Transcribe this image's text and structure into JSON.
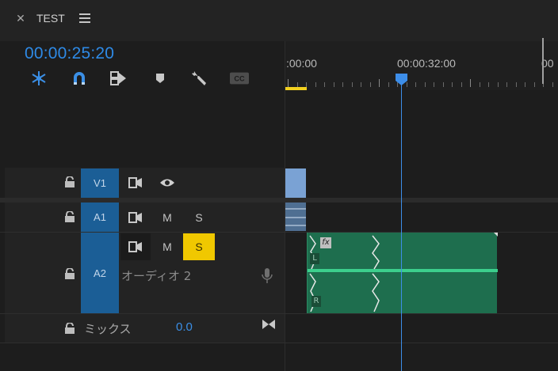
{
  "tab": {
    "close_icon": "close-icon",
    "title": "TEST",
    "menu_icon": "menu-icon"
  },
  "timecode": "00:00:25:20",
  "toolbar": [
    {
      "name": "nest-toggle-icon"
    },
    {
      "name": "snap-magnet-icon"
    },
    {
      "name": "linked-selection-icon"
    },
    {
      "name": "add-marker-icon"
    },
    {
      "name": "wrench-settings-icon"
    },
    {
      "name": "captions-cc-icon",
      "label": "CC"
    }
  ],
  "ruler": {
    "labels": [
      ":00:00",
      "00:00:32:00",
      "00"
    ]
  },
  "tracks": {
    "v1": {
      "target": "V1",
      "eye_icon": "eye-icon"
    },
    "a1": {
      "target": "A1",
      "mute": "M",
      "solo": "S"
    },
    "a2": {
      "target": "A2",
      "mute": "M",
      "solo": "S",
      "name": "オーディオ 2",
      "mic_icon": "microphone-icon"
    },
    "mix": {
      "label": "ミックス",
      "value": "0.0"
    }
  },
  "clip_a2": {
    "fx": "fx",
    "left_channel": "L",
    "right_channel": "R"
  },
  "colors": {
    "timecode": "#2e8ae6",
    "playhead": "#3d8ee9",
    "solo_active": "#f0c800",
    "target": "#1b5e96",
    "audio_clip": "#1e6e4e",
    "video_clip": "#7aa2d4"
  }
}
